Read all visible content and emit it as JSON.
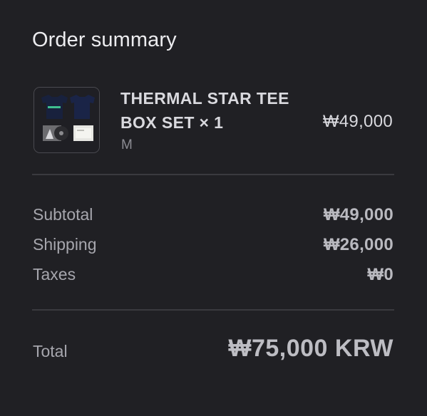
{
  "summary": {
    "title": "Order summary"
  },
  "item": {
    "image_icon": "product-box-set-thumbnail",
    "name": "THERMAL STAR TEE BOX SET × 1",
    "variant": "M",
    "price": "₩49,000"
  },
  "totals": {
    "subtotal_label": "Subtotal",
    "subtotal_value": "₩49,000",
    "shipping_label": "Shipping",
    "shipping_value": "₩26,000",
    "taxes_label": "Taxes",
    "taxes_value": "₩0",
    "total_label": "Total",
    "total_value": "₩75,000 KRW"
  },
  "colors": {
    "background": "#202024",
    "divider": "#3a3a3f",
    "text_primary": "#e6e6ea",
    "text_muted": "#a6a6ad"
  }
}
